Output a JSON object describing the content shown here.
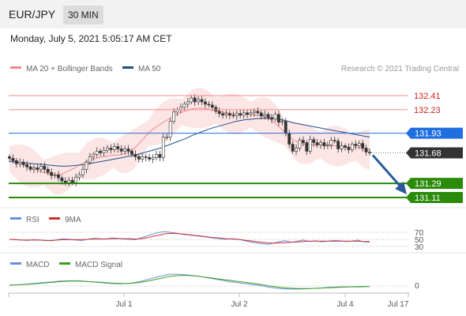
{
  "header": {
    "symbol": "EUR/JPY",
    "timeframe": "30 MIN"
  },
  "timestamp": "Monday, July 5, 2021 5:05:17 AM CET",
  "source": "Research © 2021 Trading Central",
  "colors": {
    "ma20": "#f08a8a",
    "ma50": "#1f4e8c",
    "resistance": "#f28b8b",
    "support": "#2a8a0a",
    "pivot": "#1f6fe0",
    "last": "#333333",
    "rsi": "#6b8fdc",
    "rsi_ma": "#d03030",
    "macd": "#6b8fdc",
    "macd_signal": "#3aa01a",
    "arrow": "#2a5a9a"
  },
  "chart_data": [
    {
      "type": "candlestick",
      "legend": [
        {
          "label": "MA 20 + Bollinger Bands",
          "color": "#f08a8a"
        },
        {
          "label": "MA 50",
          "color": "#1f4e8c"
        }
      ],
      "levels": [
        {
          "value": 132.41,
          "label": "132.41",
          "kind": "resistance"
        },
        {
          "value": 132.23,
          "label": "132.23",
          "kind": "resistance"
        },
        {
          "value": 131.93,
          "label": "131.93",
          "kind": "pivot"
        },
        {
          "value": 131.68,
          "label": "131.68",
          "kind": "last"
        },
        {
          "value": 131.29,
          "label": "131.29",
          "kind": "support"
        },
        {
          "value": 131.11,
          "label": "131.11",
          "kind": "support"
        }
      ],
      "close": [
        131.61,
        131.58,
        131.54,
        131.56,
        131.53,
        131.5,
        131.47,
        131.49,
        131.47,
        131.51,
        131.47,
        131.43,
        131.39,
        131.4,
        131.36,
        131.32,
        131.3,
        131.33,
        131.3,
        131.37,
        131.4,
        131.47,
        131.56,
        131.63,
        131.66,
        131.7,
        131.68,
        131.71,
        131.74,
        131.72,
        131.76,
        131.73,
        131.7,
        131.73,
        131.7,
        131.66,
        131.63,
        131.6,
        131.63,
        131.62,
        131.6,
        131.62,
        131.66,
        131.62,
        131.88,
        131.88,
        132.08,
        132.2,
        132.23,
        132.26,
        132.3,
        132.33,
        132.38,
        132.33,
        132.36,
        132.33,
        132.3,
        132.29,
        132.26,
        132.21,
        132.18,
        132.16,
        132.18,
        132.16,
        132.15,
        132.18,
        132.16,
        132.19,
        132.17,
        132.19,
        132.21,
        132.19,
        132.15,
        132.17,
        132.13,
        132.11,
        132.17,
        132.07,
        132.08,
        131.93,
        131.79,
        131.7,
        131.74,
        131.84,
        131.81,
        131.7,
        131.85,
        131.81,
        131.78,
        131.81,
        131.77,
        131.78,
        131.84,
        131.83,
        131.73,
        131.77,
        131.75,
        131.72,
        131.79,
        131.77,
        131.8,
        131.74,
        131.69,
        131.68
      ],
      "ma20": [
        131.6,
        131.58,
        131.55,
        131.52,
        131.5,
        131.48,
        131.45,
        131.43,
        131.41,
        131.4,
        131.4,
        131.42,
        131.45,
        131.48,
        131.52,
        131.55,
        131.58,
        131.6,
        131.62,
        131.63,
        131.64,
        131.65,
        131.65,
        131.66,
        131.68,
        131.72,
        131.78,
        131.85,
        131.92,
        131.98,
        132.02,
        132.06,
        132.1,
        132.14,
        132.17,
        132.2,
        132.22,
        132.24,
        132.25,
        132.25,
        132.24,
        132.23,
        132.22,
        132.2,
        132.19,
        132.18,
        132.17,
        132.17,
        132.17,
        132.17,
        132.16,
        132.15,
        132.13,
        132.1,
        132.05,
        131.99,
        131.93,
        131.87,
        131.83,
        131.8,
        131.79,
        131.78,
        131.78,
        131.78,
        131.77,
        131.77,
        131.77,
        131.76,
        131.76,
        131.75,
        131.75,
        131.74,
        131.73,
        131.72
      ],
      "ma50": [
        131.57,
        131.56,
        131.55,
        131.54,
        131.53,
        131.52,
        131.51,
        131.51,
        131.52,
        131.53,
        131.55,
        131.57,
        131.59,
        131.61,
        131.63,
        131.65,
        131.68,
        131.71,
        131.74,
        131.78,
        131.82,
        131.86,
        131.91,
        131.95,
        131.99,
        132.02,
        132.05,
        132.08,
        132.1,
        132.11,
        132.12,
        132.12,
        132.11,
        132.09,
        132.06,
        132.04,
        132.02,
        132.0,
        131.98,
        131.96,
        131.94,
        131.92,
        131.9,
        131.88
      ],
      "x_ticks": [
        "Jul 1",
        "Jul 2",
        "Jul 4",
        "Jul 17"
      ]
    },
    {
      "type": "line",
      "legend": [
        {
          "label": "RSI",
          "color": "#6b8fdc"
        },
        {
          "label": "9MA",
          "color": "#d03030"
        }
      ],
      "ticks": [
        "70",
        "50",
        "30"
      ],
      "rsi": [
        50,
        49,
        48,
        47,
        49,
        48,
        47,
        46,
        49,
        52,
        50,
        48,
        47,
        50,
        53,
        52,
        51,
        54,
        53,
        51,
        50,
        49,
        55,
        60,
        66,
        70,
        72,
        69,
        67,
        64,
        62,
        60,
        58,
        56,
        54,
        52,
        50,
        52,
        51,
        47,
        43,
        40,
        38,
        36,
        39,
        44,
        46,
        42,
        45,
        48,
        44,
        46,
        43,
        45,
        47,
        46,
        44,
        45,
        48,
        43,
        42
      ],
      "rsi_ma": [
        50,
        49,
        48,
        48,
        48,
        48,
        47,
        47,
        48,
        49,
        49,
        49,
        49,
        50,
        51,
        51,
        51,
        52,
        52,
        52,
        52,
        51,
        52,
        55,
        59,
        62,
        66,
        67,
        66,
        65,
        63,
        61,
        59,
        57,
        55,
        54,
        52,
        51,
        50,
        48,
        46,
        44,
        42,
        40,
        39,
        40,
        41,
        42,
        43,
        44,
        45,
        45,
        45,
        45,
        45,
        45,
        45,
        45,
        45,
        44,
        44
      ]
    },
    {
      "type": "line",
      "legend": [
        {
          "label": "MACD",
          "color": "#6b8fdc"
        },
        {
          "label": "MACD Signal",
          "color": "#3aa01a"
        }
      ],
      "ticks": [
        "0"
      ],
      "macd": [
        0.02,
        0.03,
        0.05,
        0.07,
        0.09,
        0.11,
        0.12,
        0.12,
        0.1,
        0.08,
        0.06,
        0.05,
        0.06,
        0.1,
        0.16,
        0.22,
        0.27,
        0.27,
        0.25,
        0.22,
        0.18,
        0.14,
        0.1,
        0.07,
        0.04,
        0.01,
        -0.03,
        -0.06,
        -0.07,
        -0.07,
        -0.06,
        -0.05,
        -0.03,
        -0.02,
        -0.02,
        -0.01,
        -0.01
      ],
      "macd_signal": [
        0.02,
        0.03,
        0.04,
        0.06,
        0.08,
        0.1,
        0.11,
        0.11,
        0.1,
        0.09,
        0.07,
        0.06,
        0.06,
        0.08,
        0.12,
        0.17,
        0.22,
        0.24,
        0.24,
        0.22,
        0.19,
        0.16,
        0.13,
        0.1,
        0.07,
        0.04,
        0.0,
        -0.03,
        -0.05,
        -0.06,
        -0.06,
        -0.05,
        -0.04,
        -0.03,
        -0.02,
        -0.02,
        -0.01
      ]
    }
  ]
}
